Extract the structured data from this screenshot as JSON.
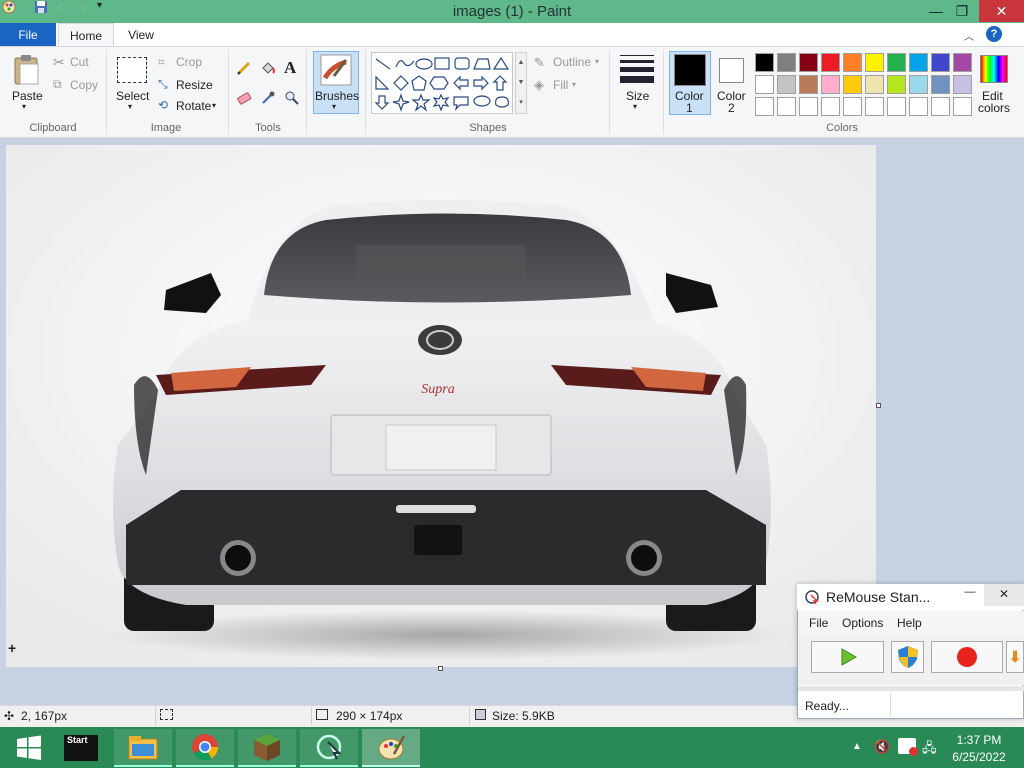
{
  "window": {
    "title": "images (1) - Paint"
  },
  "quick_access": [
    "paint-app-icon",
    "save-icon",
    "undo-icon",
    "redo-icon",
    "customize-arrow-icon"
  ],
  "window_controls": {
    "minimize": "—",
    "restore": "❐",
    "close": "✕"
  },
  "tabs": {
    "file": "File",
    "home": "Home",
    "view": "View"
  },
  "ribbon": {
    "clipboard": {
      "paste": "Paste",
      "cut": "Cut",
      "copy": "Copy",
      "label": "Clipboard"
    },
    "image": {
      "select": "Select",
      "crop": "Crop",
      "resize": "Resize",
      "rotate": "Rotate",
      "label": "Image"
    },
    "tools": {
      "label": "Tools",
      "text_glyph": "A"
    },
    "brushes": {
      "label": "Brushes"
    },
    "shapes": {
      "outline": "Outline",
      "fill": "Fill",
      "label": "Shapes"
    },
    "size": {
      "label": "Size"
    },
    "colors": {
      "color1": "Color",
      "color1_num": "1",
      "color2": "Color",
      "color2_num": "2",
      "edit_line1": "Edit",
      "edit_line2": "colors",
      "label": "Colors",
      "color1_value": "#000000",
      "color2_value": "#ffffff",
      "palette_row1": [
        "#000000",
        "#7f7f7f",
        "#880015",
        "#ed1c24",
        "#ff7f27",
        "#fff200",
        "#22b14c",
        "#00a2e8",
        "#3f48cc",
        "#a349a4"
      ],
      "palette_row2": [
        "#ffffff",
        "#c3c3c3",
        "#b97a57",
        "#ffaec9",
        "#ffc90e",
        "#efe4b0",
        "#b5e61d",
        "#99d9ea",
        "#7092be",
        "#c8bfe7"
      ]
    }
  },
  "status": {
    "cursor_pos": "2, 167px",
    "selection": "",
    "image_size": "290 × 174px",
    "file_size": "Size: 5.9KB"
  },
  "remouse": {
    "title": "ReMouse Stan...",
    "menu": [
      "File",
      "Options",
      "Help"
    ],
    "status": "Ready..."
  },
  "taskbar": {
    "start_label": "Start",
    "apps": [
      "windows-start-icon",
      "start-app-icon",
      "file-explorer-icon",
      "chrome-icon",
      "minecraft-icon",
      "remouse-icon",
      "paint-icon"
    ],
    "time": "1:37 PM",
    "date": "6/25/2022"
  },
  "car": {
    "badge": "Supra"
  }
}
